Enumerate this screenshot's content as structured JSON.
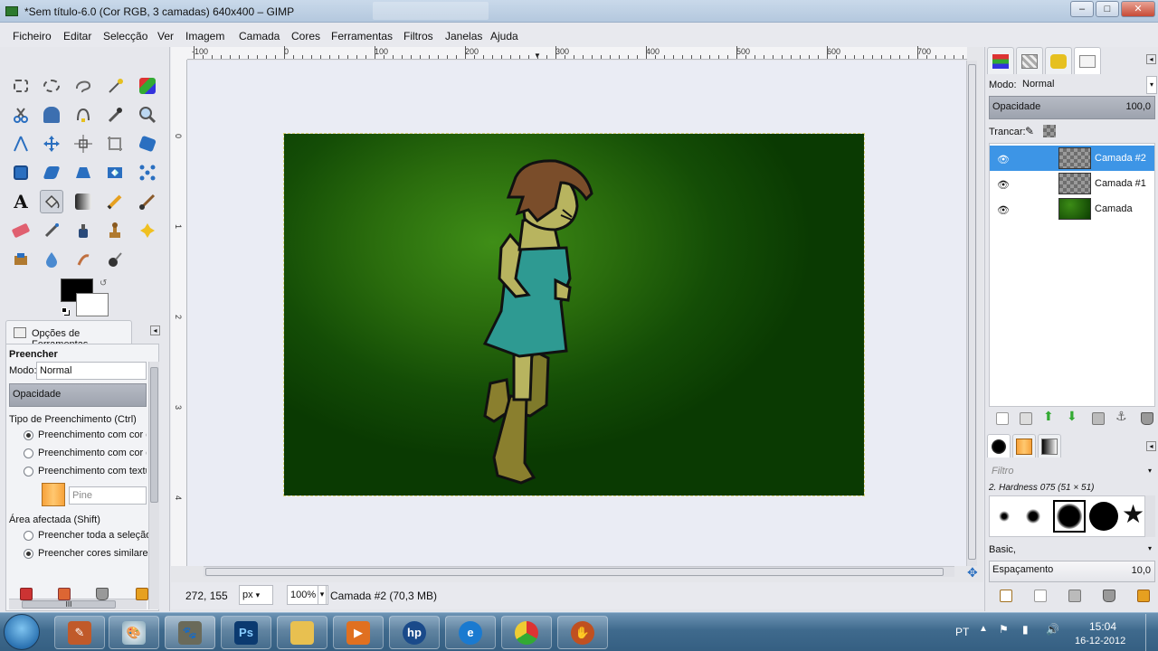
{
  "window": {
    "title": "*Sem título-6.0 (Cor RGB, 3 camadas) 640x400 – GIMP",
    "controls": [
      "–",
      "□",
      "✕"
    ]
  },
  "menu": [
    "Ficheiro",
    "Editar",
    "Selecção",
    "Ver",
    "Imagem",
    "Camada",
    "Cores",
    "Ferramentas",
    "Filtros",
    "Janelas",
    "Ajuda"
  ],
  "tool_options": {
    "tab_label": "Opções de Ferramentas",
    "tool_name": "Preencher",
    "mode_label": "Modo:",
    "mode_value": "Normal",
    "opacity_label": "Opacidade",
    "fill_type_label": "Tipo de Preenchimento (Ctrl)",
    "fill_options": [
      "Preenchimento com cor de",
      "Preenchimento com cor de",
      "Preenchimento com textur"
    ],
    "pattern_name": "Pine",
    "area_label": "Área afectada (Shift)",
    "area_options": [
      "Preencher toda a seleção",
      "Preencher cores similares"
    ],
    "scroll_grip": "III"
  },
  "rulers": {
    "top": [
      "-100",
      "0",
      "100",
      "200",
      "300",
      "400",
      "500",
      "600",
      "700"
    ],
    "left": [
      "0",
      "1",
      "2",
      "3",
      "4"
    ]
  },
  "status": {
    "coords": "272, 155",
    "unit": "px",
    "zoom": "100%",
    "layer_info": "Camada #2 (70,3 MB)"
  },
  "layers_panel": {
    "mode_label": "Modo:",
    "mode_value": "Normal",
    "opacity_label": "Opacidade",
    "opacity_value": "100,0",
    "lock_label": "Trancar:",
    "layers": [
      {
        "name": "Camada #2",
        "selected": true
      },
      {
        "name": "Camada #1",
        "selected": false
      },
      {
        "name": "Camada",
        "selected": false
      }
    ]
  },
  "brushes_panel": {
    "filter_placeholder": "Filtro",
    "brush_name": "2. Hardness 075 (51 × 51)",
    "tag": "Basic,",
    "spacing_label": "Espaçamento",
    "spacing_value": "10,0"
  },
  "taskbar": {
    "language": "PT",
    "time": "15:04",
    "date": "16-12-2012"
  },
  "colors": {
    "fg": "#000000",
    "bg": "#ffffff",
    "selected_layer": "#3d95e6"
  }
}
